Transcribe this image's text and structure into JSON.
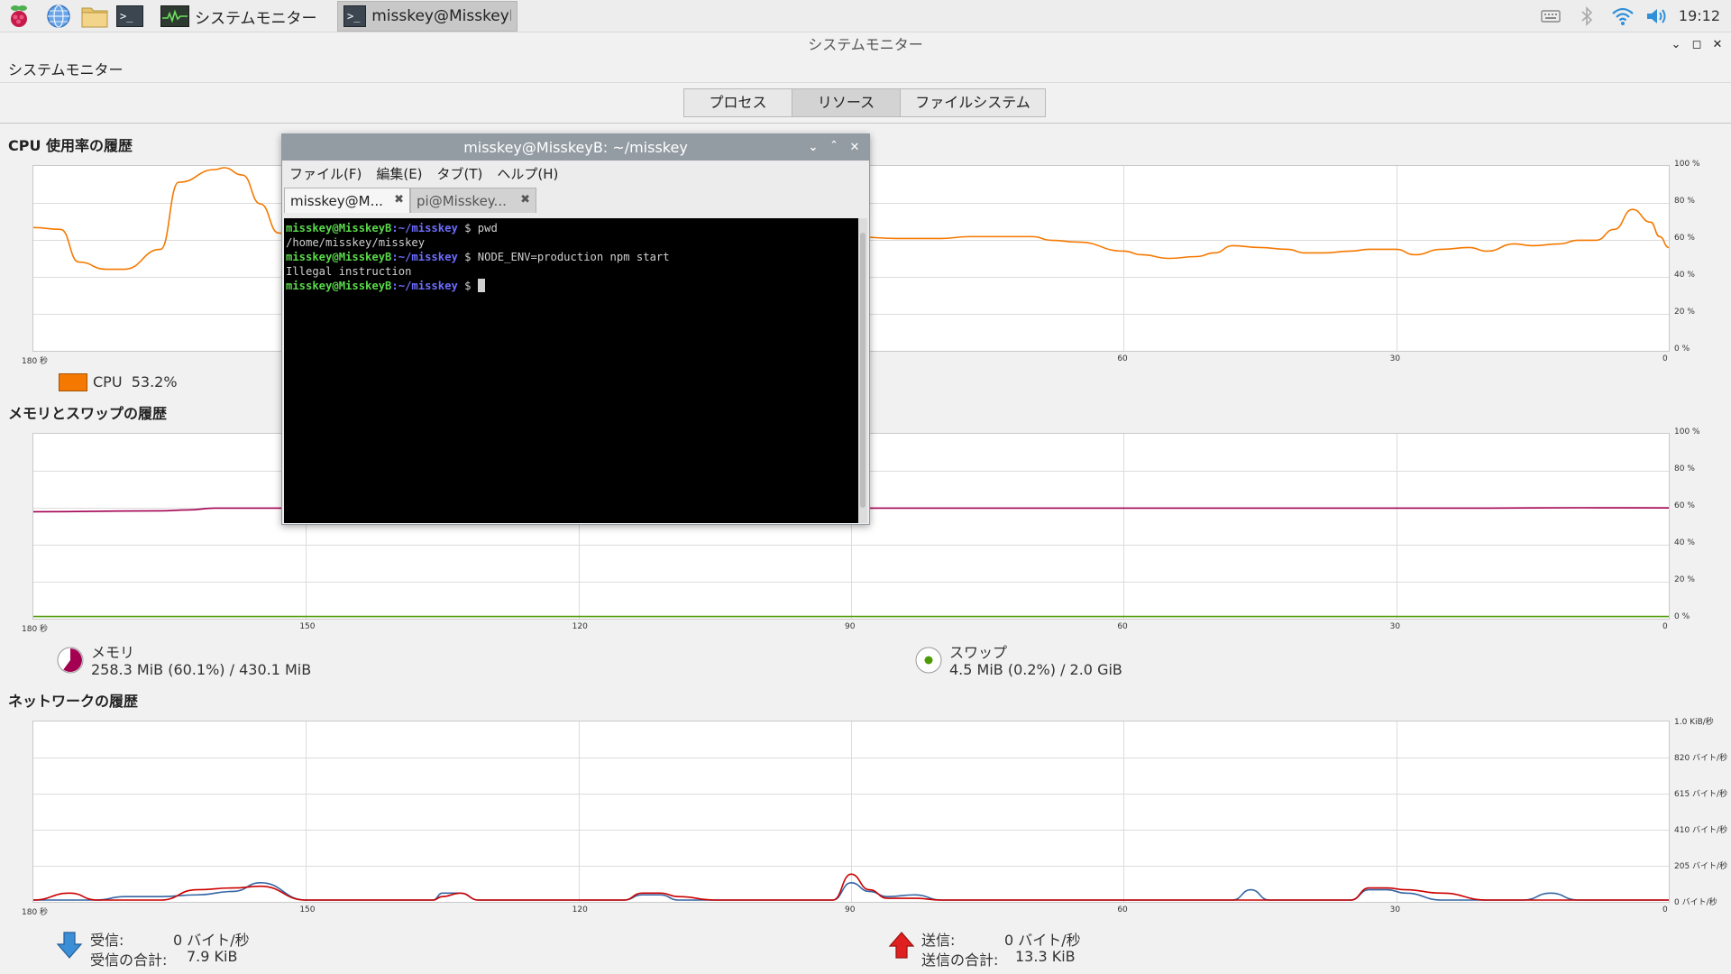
{
  "taskbar": {
    "tasks": [
      {
        "label": "システムモニター",
        "active": false
      },
      {
        "label": "misskey@MisskeyB: ...",
        "active": true
      }
    ],
    "clock": "19:12"
  },
  "window": {
    "title": "システムモニター",
    "menu_label": "システムモニター",
    "tabs": [
      "プロセス",
      "リソース",
      "ファイルシステム"
    ],
    "selected_tab": "リソース"
  },
  "cpu": {
    "title": "CPU 使用率の履歴",
    "legend_label": "CPU",
    "legend_value": "53.2%",
    "color": "#f57900"
  },
  "memory": {
    "title": "メモリとスワップの履歴",
    "mem_label": "メモリ",
    "mem_value": "258.3 MiB (60.1%) / 430.1 MiB",
    "swap_label": "スワップ",
    "swap_value": "4.5 MiB (0.2%) / 2.0 GiB",
    "mem_color": "#a40052",
    "swap_color": "#4e9a06"
  },
  "network": {
    "title": "ネットワークの履歴",
    "recv_label": "受信:",
    "recv_value": "0 バイト/秒",
    "recv_total_label": "受信の合計:",
    "recv_total_value": "7.9 KiB",
    "send_label": "送信:",
    "send_value": "0 バイト/秒",
    "send_total_label": "送信の合計:",
    "send_total_value": "13.3 KiB",
    "recv_color": "#3465a4",
    "send_color": "#cc0000"
  },
  "axes": {
    "x_labels": [
      "180 秒",
      "150",
      "120",
      "90",
      "60",
      "30",
      "0"
    ],
    "y_percent": [
      "100 %",
      "80 %",
      "60 %",
      "40 %",
      "20 %",
      "0 %"
    ],
    "y_network": [
      "1.0 KiB/秒",
      "820 バイト/秒",
      "615 バイト/秒",
      "410 バイト/秒",
      "205 バイト/秒",
      "0 バイト/秒"
    ]
  },
  "chart_data": [
    {
      "type": "line",
      "title": "CPU 使用率の履歴",
      "xlabel": "",
      "ylabel": "",
      "x_range": [
        180,
        0
      ],
      "ylim": [
        0,
        100
      ],
      "series": [
        {
          "name": "CPU",
          "x": [
            180,
            177,
            175,
            172,
            170,
            166,
            164,
            160,
            159,
            157,
            155,
            153,
            151,
            149,
            146,
            144,
            140,
            136,
            130,
            128,
            125,
            120,
            110,
            100,
            90,
            85,
            80,
            77,
            75,
            72,
            70,
            68,
            65,
            60,
            58,
            55,
            52,
            50,
            48,
            45,
            42,
            40,
            38,
            35,
            33,
            30,
            28,
            25,
            22,
            20,
            17,
            15,
            12,
            10,
            8,
            6,
            4,
            2,
            1,
            0
          ],
          "values": [
            67,
            66,
            48,
            44,
            44,
            55,
            92,
            99,
            100,
            96,
            80,
            64,
            58,
            59,
            60,
            60,
            60,
            62,
            62,
            60,
            63,
            61,
            60,
            61,
            62,
            61,
            61,
            62,
            62,
            62,
            62,
            60,
            59,
            54,
            52,
            50,
            51,
            53,
            57,
            56,
            55,
            53,
            53,
            54,
            55,
            55,
            52,
            55,
            56,
            54,
            58,
            57,
            58,
            60,
            60,
            66,
            77,
            70,
            62,
            56
          ]
        }
      ]
    },
    {
      "type": "line",
      "title": "メモリとスワップの履歴",
      "xlabel": "",
      "ylabel": "",
      "x_range": [
        180,
        0
      ],
      "ylim": [
        0,
        100
      ],
      "series": [
        {
          "name": "メモリ",
          "x": [
            180,
            166,
            163,
            160,
            150,
            140,
            130,
            120,
            110,
            100,
            90,
            80,
            70,
            60,
            50,
            40,
            30,
            20,
            10,
            0
          ],
          "values": [
            58,
            58.5,
            59,
            60,
            60,
            60,
            60,
            60,
            60,
            60,
            60,
            60,
            60,
            60,
            60,
            60,
            60,
            60,
            60.2,
            60.1
          ]
        },
        {
          "name": "スワップ",
          "x": [
            180,
            0
          ],
          "values": [
            0.2,
            0.2
          ]
        }
      ]
    },
    {
      "type": "line",
      "title": "ネットワークの履歴",
      "xlabel": "",
      "ylabel": "",
      "x_range": [
        180,
        0
      ],
      "ylim": [
        0,
        1024
      ],
      "series": [
        {
          "name": "受信",
          "x": [
            180,
            176,
            173,
            170,
            166,
            162,
            158,
            155,
            150,
            145,
            140,
            136,
            135,
            133,
            131,
            129,
            124,
            120,
            115,
            113,
            111,
            109,
            105,
            100,
            96,
            92,
            90,
            88,
            86,
            83,
            80,
            76,
            70,
            65,
            60,
            55,
            48,
            46,
            44,
            40,
            35,
            33,
            31,
            29,
            25,
            20,
            16,
            13,
            10,
            5,
            0
          ],
          "values": [
            0,
            0,
            0,
            20,
            20,
            30,
            50,
            100,
            0,
            0,
            0,
            0,
            40,
            40,
            0,
            0,
            0,
            0,
            0,
            30,
            30,
            0,
            0,
            0,
            0,
            0,
            100,
            50,
            20,
            30,
            0,
            0,
            0,
            0,
            0,
            0,
            0,
            60,
            0,
            0,
            0,
            60,
            60,
            40,
            0,
            0,
            0,
            40,
            0,
            0,
            0
          ]
        },
        {
          "name": "送信",
          "x": [
            180,
            176,
            173,
            170,
            166,
            162,
            158,
            155,
            150,
            145,
            140,
            136,
            135,
            133,
            131,
            129,
            124,
            120,
            115,
            113,
            111,
            109,
            105,
            100,
            96,
            92,
            90,
            88,
            86,
            83,
            80,
            76,
            70,
            65,
            60,
            55,
            48,
            46,
            44,
            40,
            35,
            33,
            31,
            29,
            25,
            20,
            16,
            13,
            10,
            5,
            0
          ],
          "values": [
            0,
            40,
            0,
            0,
            0,
            60,
            70,
            80,
            0,
            0,
            0,
            0,
            20,
            40,
            0,
            0,
            0,
            0,
            0,
            40,
            40,
            20,
            0,
            0,
            0,
            0,
            150,
            60,
            10,
            10,
            0,
            0,
            0,
            0,
            0,
            0,
            0,
            0,
            0,
            0,
            0,
            70,
            70,
            60,
            40,
            0,
            0,
            0,
            0,
            0,
            0
          ]
        }
      ]
    }
  ],
  "terminal": {
    "title": "misskey@MisskeyB: ~/misskey",
    "menu": [
      "ファイル(F)",
      "編集(E)",
      "タブ(T)",
      "ヘルプ(H)"
    ],
    "tabs": [
      "misskey@M...",
      "pi@Misskey..."
    ],
    "lines": [
      {
        "user": "misskey@MisskeyB",
        "path": ":~/misskey",
        "cmd": " $ pwd"
      },
      {
        "output": "/home/misskey/misskey"
      },
      {
        "user": "misskey@MisskeyB",
        "path": ":~/misskey",
        "cmd": " $ NODE_ENV=production npm start"
      },
      {
        "output": "Illegal instruction"
      },
      {
        "user": "misskey@MisskeyB",
        "path": ":~/misskey",
        "cmd": " $ "
      }
    ]
  }
}
